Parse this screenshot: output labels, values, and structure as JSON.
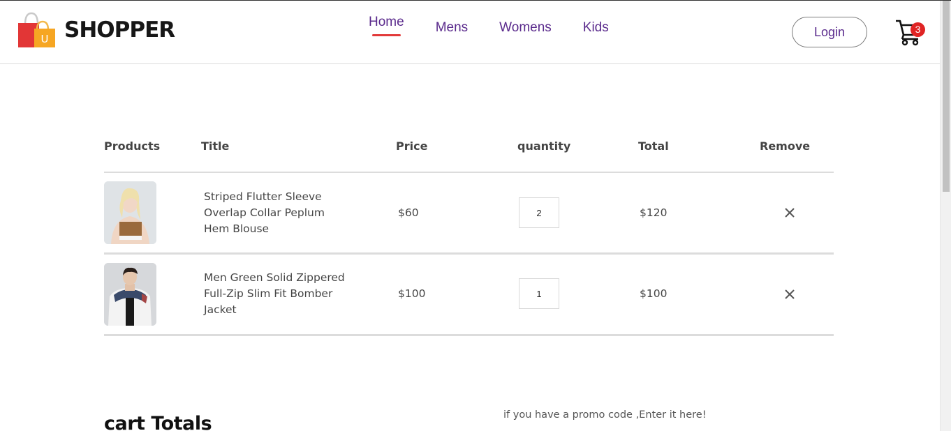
{
  "brand": {
    "name": "SHOPPER",
    "logo_letter": "U"
  },
  "nav": {
    "items": [
      {
        "label": "Home",
        "active": true
      },
      {
        "label": "Mens",
        "active": false
      },
      {
        "label": "Womens",
        "active": false
      },
      {
        "label": "Kids",
        "active": false
      }
    ],
    "login_label": "Login",
    "cart_count": "3"
  },
  "cart": {
    "headers": [
      "Products",
      "Title",
      "Price",
      "quantity",
      "Total",
      "Remove"
    ],
    "rows": [
      {
        "title": "Striped Flutter Sleeve Overlap Collar Peplum Hem Blouse",
        "price": "$60",
        "quantity": "2",
        "total": "$120"
      },
      {
        "title": "Men Green Solid Zippered Full-Zip Slim Fit Bomber Jacket",
        "price": "$100",
        "quantity": "1",
        "total": "$100"
      }
    ]
  },
  "totals": {
    "title": "cart Totals"
  },
  "promo": {
    "text": "if you have a promo code ,Enter it here!"
  },
  "colors": {
    "accent": "#e23a3a",
    "nav_text": "#5a2a8c",
    "badge": "#e02424"
  }
}
